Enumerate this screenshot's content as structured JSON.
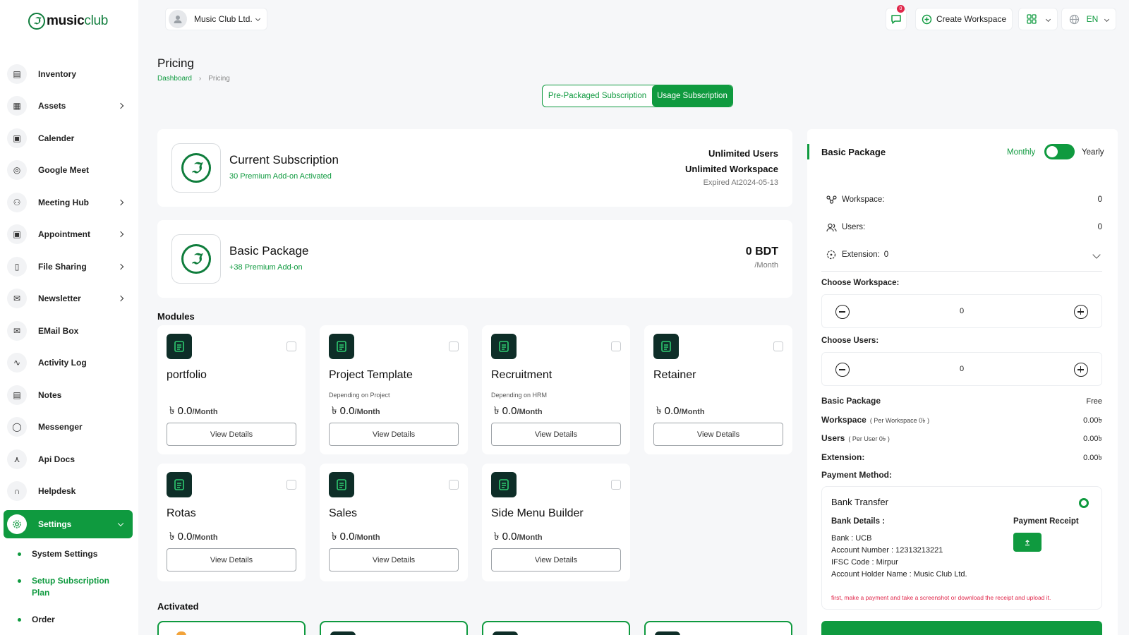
{
  "brand": {
    "logo_prefix": "music",
    "logo_suffix": "club"
  },
  "topbar": {
    "org_name": "Music Club Ltd.",
    "notif_count": "0",
    "create_workspace": "Create Workspace",
    "lang": "EN"
  },
  "sidebar": {
    "items": [
      {
        "label": "Inventory",
        "icon": "document-icon",
        "chevron": false
      },
      {
        "label": "Assets",
        "icon": "clipboard-icon",
        "chevron": true
      },
      {
        "label": "Calender",
        "icon": "calendar-icon",
        "chevron": false
      },
      {
        "label": "Google Meet",
        "icon": "meet-icon",
        "chevron": false
      },
      {
        "label": "Meeting Hub",
        "icon": "users-icon",
        "chevron": true
      },
      {
        "label": "Appointment",
        "icon": "calendar-check-icon",
        "chevron": true
      },
      {
        "label": "File Sharing",
        "icon": "file-icon",
        "chevron": true
      },
      {
        "label": "Newsletter",
        "icon": "mail-icon",
        "chevron": true
      },
      {
        "label": "EMail Box",
        "icon": "inbox-icon",
        "chevron": false
      },
      {
        "label": "Activity Log",
        "icon": "activity-icon",
        "chevron": false
      },
      {
        "label": "Notes",
        "icon": "notes-icon",
        "chevron": false
      },
      {
        "label": "Messenger",
        "icon": "chat-icon",
        "chevron": false
      },
      {
        "label": "Api Docs",
        "icon": "api-icon",
        "chevron": false
      },
      {
        "label": "Helpdesk",
        "icon": "headset-icon",
        "chevron": false
      }
    ],
    "settings_label": "Settings",
    "submenu": [
      "System Settings",
      "Setup Subscription Plan",
      "Order"
    ]
  },
  "page": {
    "title": "Pricing",
    "breadcrumb": [
      "Dashboard",
      "Pricing"
    ],
    "tabs": [
      "Pre-Packaged Subscription",
      "Usage Subscription"
    ]
  },
  "current_subscription": {
    "title": "Current Subscription",
    "subtitle": "30 Premium Add-on Activated",
    "users": "Unlimited Users",
    "workspace": "Unlimited Workspace",
    "expiry": "Expired At2024-05-13"
  },
  "basic_package": {
    "title": "Basic Package",
    "subtitle": "+38 Premium Add-on",
    "price": "0 BDT",
    "period": "/Month"
  },
  "modules_title": "Modules",
  "modules": [
    {
      "name": "portfolio",
      "dep": "",
      "currency": "৳",
      "price": "0.0",
      "unit": "/Month",
      "button": "View Details"
    },
    {
      "name": "Project Template",
      "dep": "Depending on Project",
      "currency": "৳",
      "price": "0.0",
      "unit": "/Month",
      "button": "View Details"
    },
    {
      "name": "Recruitment",
      "dep": "Depending on HRM",
      "currency": "৳",
      "price": "0.0",
      "unit": "/Month",
      "button": "View Details"
    },
    {
      "name": "Retainer",
      "dep": "",
      "currency": "৳",
      "price": "0.0",
      "unit": "/Month",
      "button": "View Details"
    },
    {
      "name": "Rotas",
      "dep": "",
      "currency": "৳",
      "price": "0.0",
      "unit": "/Month",
      "button": "View Details"
    },
    {
      "name": "Sales",
      "dep": "",
      "currency": "৳",
      "price": "0.0",
      "unit": "/Month",
      "button": "View Details"
    },
    {
      "name": "Side Menu Builder",
      "dep": "",
      "currency": "৳",
      "price": "0.0",
      "unit": "/Month",
      "button": "View Details"
    }
  ],
  "activated_title": "Activated",
  "panel": {
    "title": "Basic Package",
    "monthly": "Monthly",
    "yearly": "Yearly",
    "workspace_label": "Workspace:",
    "workspace_val": "0",
    "users_label": "Users:",
    "users_val": "0",
    "extension_label": "Extension:",
    "extension_val": "0",
    "choose_workspace": "Choose Workspace:",
    "choose_workspace_val": "0",
    "choose_users": "Choose Users:",
    "choose_users_val": "0",
    "summary": [
      {
        "k": "Basic Package",
        "note": "",
        "v": "Free"
      },
      {
        "k": "Workspace",
        "note": "( Per Workspace 0৳ )",
        "v": "0.00৳"
      },
      {
        "k": "Users",
        "note": "( Per User 0৳ )",
        "v": "0.00৳"
      },
      {
        "k": "Extension:",
        "note": "",
        "v": "0.00৳"
      }
    ],
    "payment_method": "Payment Method:",
    "bank": {
      "title": "Bank Transfer",
      "details_label": "Bank Details :",
      "receipt_label": "Payment Receipt",
      "lines": [
        "Bank : UCB",
        "Account Number : 12313213221",
        "IFSC Code : Mirpur",
        "Account Holder Name : Music Club Ltd."
      ],
      "warning": "first, make a payment and take a screenshot or download the receipt and upload it."
    }
  },
  "colors": {
    "accent": "#0f9a3f",
    "dark_icon": "#0e2e28",
    "alert": "#e0264a"
  }
}
